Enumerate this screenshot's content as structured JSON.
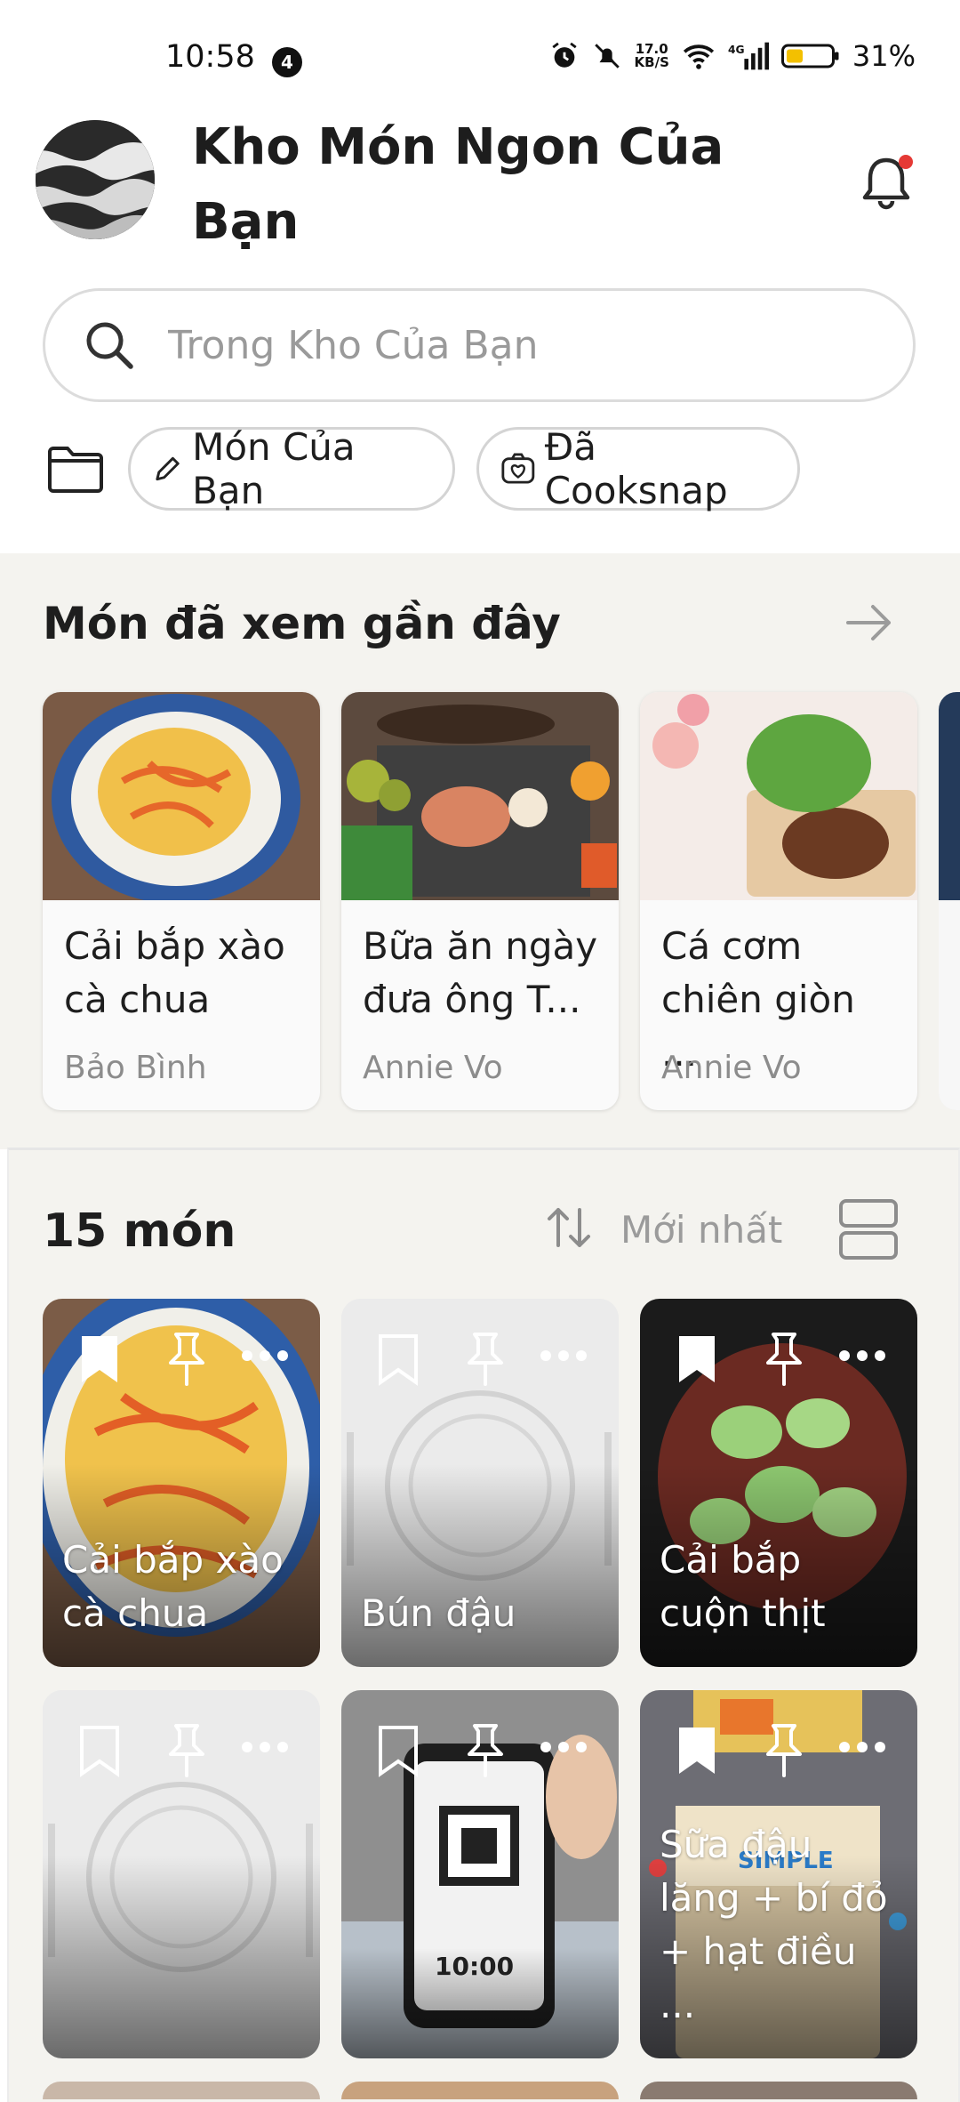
{
  "status_bar": {
    "time": "10:58",
    "notification_count": "4",
    "speed": "17.0",
    "speed_unit": "KB/S",
    "network": "4G",
    "battery": "31%"
  },
  "header": {
    "title": "Kho Món Ngon Của Bạn"
  },
  "search": {
    "placeholder": "Trong Kho Của Bạn"
  },
  "chips": {
    "my_recipes": "Món Của Bạn",
    "cooksnapped": "Đã Cooksnap"
  },
  "recent": {
    "title": "Món đã xem gần đây",
    "cards": [
      {
        "title": "Cải bắp xào cà chua",
        "author": "Bảo Bình"
      },
      {
        "title": "Bữa ăn ngày đưa ông T...",
        "author": "Annie Vo"
      },
      {
        "title": "Cá cơm chiên giòn ...",
        "author": "Annie Vo"
      }
    ]
  },
  "collection": {
    "count": "15 món",
    "sort_label": "Mới nhất",
    "cards": [
      {
        "title": "Cải bắp xào cà chua"
      },
      {
        "title": "Bún đậu"
      },
      {
        "title": "Cải bắp cuộn thịt"
      },
      {
        "title": ""
      },
      {
        "title": ""
      },
      {
        "title": "Sữa đậu lăng + bí đỏ + hạt điều ..."
      }
    ]
  },
  "colors": {
    "accent": "#e53935",
    "section_bg": "#f4f3ef"
  },
  "icons": [
    "search-icon",
    "bell-icon",
    "folder-icon",
    "pencil-icon",
    "cooksnap-icon",
    "arrow-right-icon",
    "sort-icon",
    "layout-toggle-icon",
    "bookmark-icon",
    "pin-icon",
    "more-icon"
  ]
}
